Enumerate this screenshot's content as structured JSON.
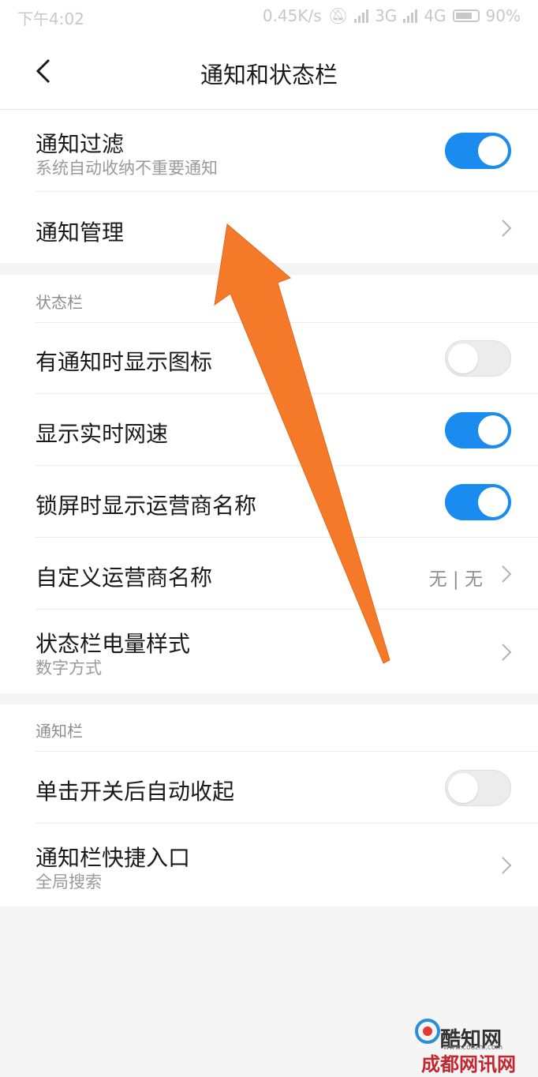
{
  "status_bar": {
    "time": "下午4:02",
    "net_speed": "0.45K/s",
    "net1": "3G",
    "net2": "4G",
    "battery": "90%"
  },
  "header": {
    "title": "通知和状态栏"
  },
  "group1": {
    "filter": {
      "label": "通知过滤",
      "sub": "系统自动收纳不重要通知",
      "on": true
    },
    "manage": {
      "label": "通知管理"
    }
  },
  "statusbar_section": {
    "title": "状态栏",
    "show_icons": {
      "label": "有通知时显示图标",
      "on": false
    },
    "net_speed": {
      "label": "显示实时网速",
      "on": true
    },
    "carrier_lock": {
      "label": "锁屏时显示运营商名称",
      "on": true
    },
    "custom_carrier": {
      "label": "自定义运营商名称",
      "value": "无 | 无"
    },
    "battery_style": {
      "label": "状态栏电量样式",
      "sub": "数字方式"
    }
  },
  "notif_section": {
    "title": "通知栏",
    "auto_collapse": {
      "label": "单击开关后自动收起",
      "on": false
    },
    "shortcut": {
      "label": "通知栏快捷入口",
      "sub": "全局搜索"
    }
  },
  "watermark": {
    "site": "酷知网",
    "url": "www.coozhi.com",
    "bottom": "成都网讯网"
  },
  "colors": {
    "accent": "#1a8cf0",
    "arrow": "#f47a2a"
  }
}
